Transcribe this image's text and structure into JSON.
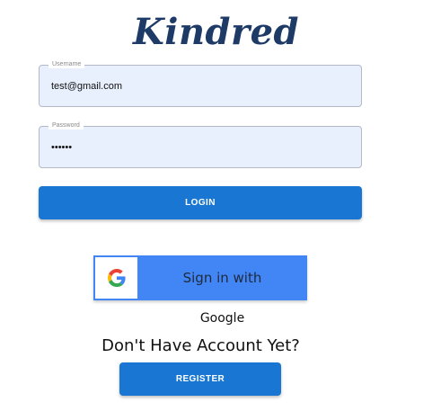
{
  "brand": {
    "logo_text": "Kindred"
  },
  "username": {
    "label": "Username",
    "value": "test@gmail.com"
  },
  "password": {
    "label": "Password",
    "value": "******"
  },
  "login_button": {
    "label": "LOGIN"
  },
  "google_signin": {
    "label": "Sign in with",
    "provider": "Google"
  },
  "signup_prompt": {
    "text": "Don't Have Account Yet?"
  },
  "register_button": {
    "label": "REGISTER"
  },
  "colors": {
    "primary": "#1976d2",
    "google_blue": "#4285f4",
    "field_bg": "#e8f0fe",
    "logo": "#1e3a66"
  }
}
